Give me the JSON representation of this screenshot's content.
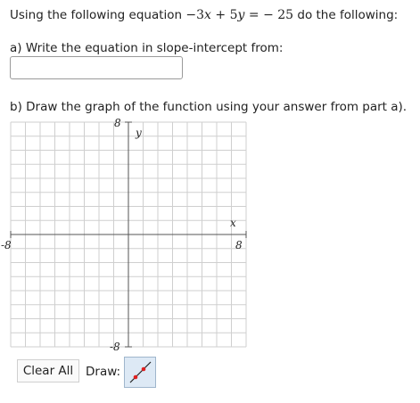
{
  "question": {
    "prefix": "Using the following equation",
    "equation_parts": [
      "−",
      "3",
      "x",
      " + ",
      "5",
      "y",
      " = ",
      "− ",
      "25"
    ],
    "suffix": "do the following:"
  },
  "part_a": {
    "label": "a) Write the equation in slope-intercept from:",
    "answer_value": ""
  },
  "part_b": {
    "label": "b) Draw the graph of the function using your answer from part a)."
  },
  "graph": {
    "x_axis_label": "x",
    "y_axis_label": "y",
    "x_min_label": "-8",
    "x_max_label": "8",
    "y_max_label": "8",
    "y_min_label": "-8",
    "x_range": [
      -8,
      8
    ],
    "y_range": [
      -8,
      8
    ],
    "grid": true
  },
  "toolbar": {
    "clear_label": "Clear All",
    "draw_label": "Draw:",
    "draw_tool_icon": "line-segment-icon",
    "draw_tool_point_color": "#e02020"
  }
}
